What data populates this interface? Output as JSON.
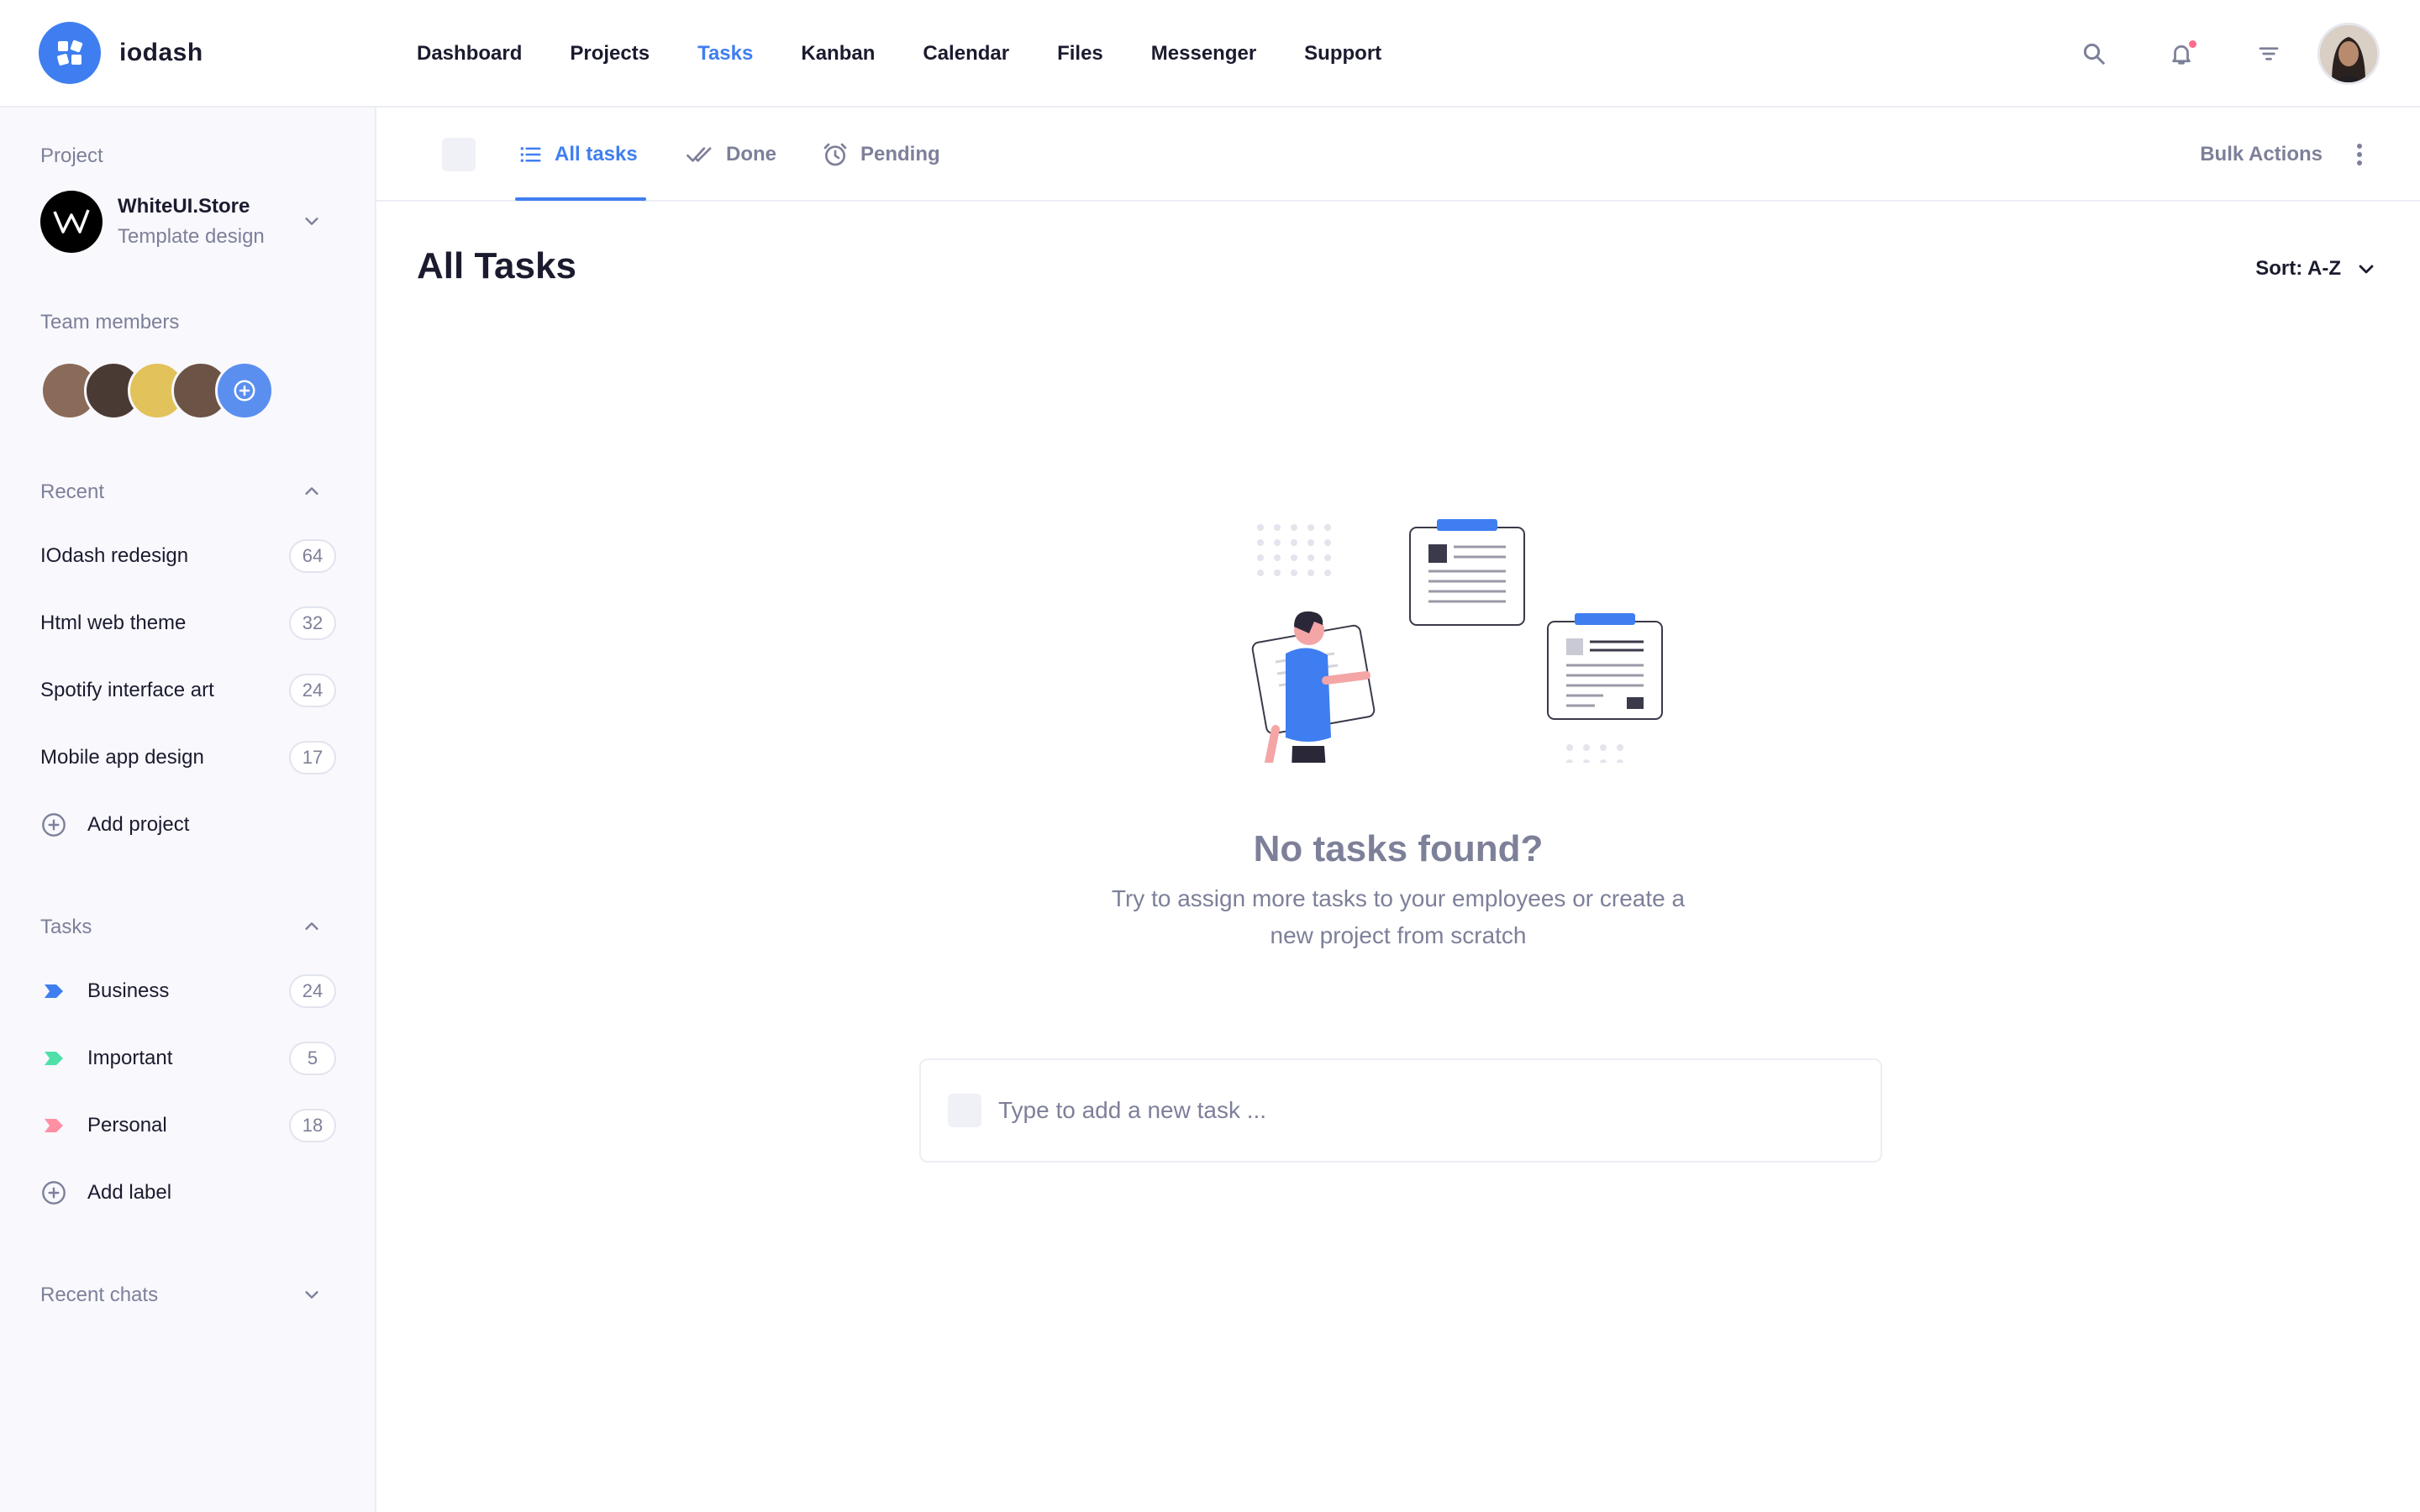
{
  "app": {
    "name": "iodash",
    "brand_color": "#3f7ef0"
  },
  "nav": {
    "items": [
      {
        "label": "Dashboard"
      },
      {
        "label": "Projects"
      },
      {
        "label": "Tasks",
        "active": true
      },
      {
        "label": "Kanban"
      },
      {
        "label": "Calendar"
      },
      {
        "label": "Files"
      },
      {
        "label": "Messenger"
      },
      {
        "label": "Support"
      }
    ],
    "icons": [
      "search-icon",
      "bell-icon",
      "filter-icon"
    ]
  },
  "sidebar": {
    "project_heading": "Project",
    "project": {
      "name": "WhiteUI.Store",
      "subtitle": "Template design"
    },
    "team_heading": "Team members",
    "recent_heading": "Recent",
    "recent": [
      {
        "label": "IOdash redesign",
        "count": "64"
      },
      {
        "label": "Html web theme",
        "count": "32"
      },
      {
        "label": "Spotify interface art",
        "count": "24"
      },
      {
        "label": "Mobile app design",
        "count": "17"
      }
    ],
    "add_project": "Add project",
    "tasks_heading": "Tasks",
    "labels": [
      {
        "label": "Business",
        "count": "24",
        "color": "#3f7ef0"
      },
      {
        "label": "Important",
        "count": "5",
        "color": "#4ee0a8"
      },
      {
        "label": "Personal",
        "count": "18",
        "color": "#ff8fa3"
      }
    ],
    "add_label": "Add label",
    "chats_heading": "Recent chats"
  },
  "tabs": {
    "items": [
      {
        "label": "All tasks",
        "active": true
      },
      {
        "label": "Done"
      },
      {
        "label": "Pending"
      }
    ],
    "bulk_actions": "Bulk Actions"
  },
  "main": {
    "title": "All Tasks",
    "sort_label": "Sort: A-Z",
    "empty_title": "No tasks found?",
    "empty_desc": "Try to assign more tasks to your employees or create a new project from scratch",
    "new_task_placeholder": "Type to add a new task ..."
  }
}
